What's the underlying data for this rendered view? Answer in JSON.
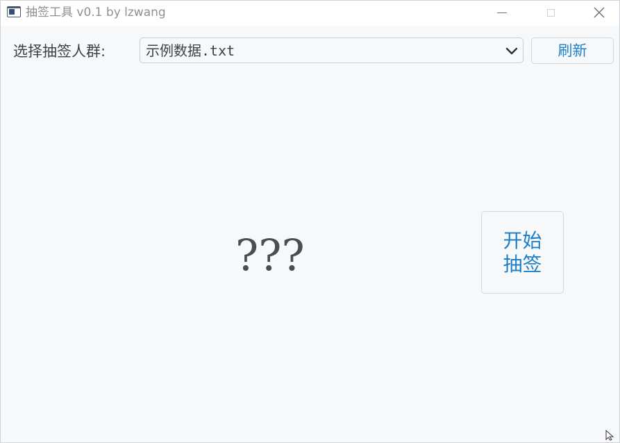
{
  "window": {
    "title": "抽签工具 v0.1 by lzwang",
    "icons": {
      "app": "app-window-icon",
      "minimize": "minimize-icon",
      "maximize": "maximize-icon",
      "close": "close-icon"
    }
  },
  "toolbar": {
    "group_label": "选择抽签人群:",
    "group_select_value": "示例数据.txt",
    "dropdown_icon": "chevron-down-icon",
    "refresh_label": "刷新"
  },
  "main": {
    "result_text": "???",
    "start_label": "开始抽签"
  },
  "colors": {
    "accent": "#1d7fc9",
    "text": "#3d4046",
    "background": "#f7f8fa",
    "titlebar": "#ffffff"
  }
}
